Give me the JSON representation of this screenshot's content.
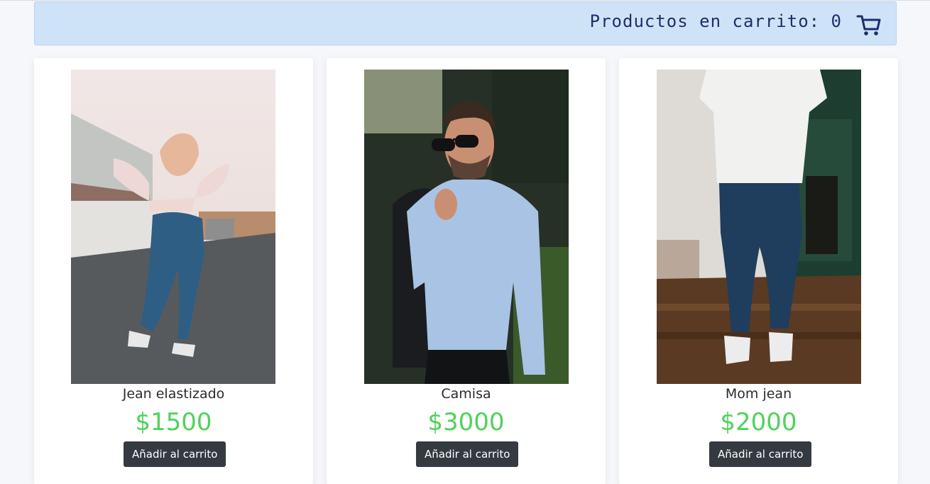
{
  "cart": {
    "label": "Productos en carrito: 0",
    "icon": "shopping-cart-icon",
    "color": "#1d2f6b"
  },
  "products": [
    {
      "name": "Jean elastizado",
      "price": "$1500",
      "button_label": "Añadir al carrito"
    },
    {
      "name": "Camisa",
      "price": "$3000",
      "button_label": "Añadir al carrito"
    },
    {
      "name": "Mom jean",
      "price": "$2000",
      "button_label": "Añadir al carrito"
    }
  ],
  "colors": {
    "header_bg": "#cfe3f8",
    "price": "#4fd25a",
    "button_bg": "#343a40"
  }
}
